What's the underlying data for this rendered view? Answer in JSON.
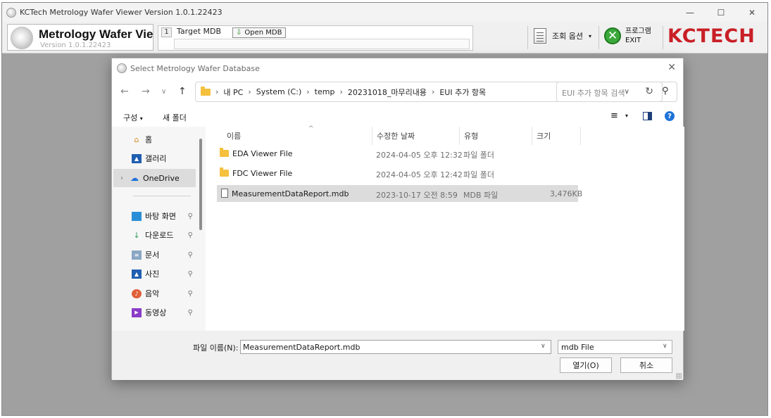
{
  "app": {
    "title": "KCTech Metrology Wafer Viewer Version 1.0.1.22423",
    "window_controls": {
      "minimize": "—",
      "maximize": "☐",
      "close": "✕"
    },
    "brand_title": "Metrology Wafer Viewer",
    "brand_version": "Version 1.0.1.22423",
    "mdb_index": "1",
    "target_mdb_label": "Target MDB",
    "open_mdb_label": "Open MDB",
    "target_mdb_value": "",
    "view_options_label": "조회 옵션",
    "exit_label_line1": "프로그램",
    "exit_label_line2": "EXIT",
    "logo_text": "KCTECH"
  },
  "dialog": {
    "title": "Select Metrology Wafer Database",
    "breadcrumb": [
      "내 PC",
      "System (C:)",
      "temp",
      "20231018_마무리내용",
      "EUI 추가 항목"
    ],
    "search_placeholder": "EUI 추가 항목 검색",
    "organize_label": "구성",
    "new_folder_label": "새 폴더",
    "sidebar": {
      "items": [
        {
          "label": "홈",
          "icon": "home-icon"
        },
        {
          "label": "갤러리",
          "icon": "gallery-icon"
        },
        {
          "label": "OneDrive",
          "icon": "cloud-icon",
          "selected": true
        },
        {
          "label": "바탕 화면",
          "icon": "desktop-icon",
          "pinned": true
        },
        {
          "label": "다운로드",
          "icon": "download-icon",
          "pinned": true
        },
        {
          "label": "문서",
          "icon": "documents-icon",
          "pinned": true
        },
        {
          "label": "사진",
          "icon": "pictures-icon",
          "pinned": true
        },
        {
          "label": "음악",
          "icon": "music-icon",
          "pinned": true
        },
        {
          "label": "동영상",
          "icon": "video-icon",
          "pinned": true
        }
      ]
    },
    "columns": {
      "name": "이름",
      "modified": "수정한 날짜",
      "type": "유형",
      "size": "크기"
    },
    "files": [
      {
        "name": "EDA Viewer File",
        "modified": "2024-04-05 오후 12:32",
        "type": "파일 폴더",
        "size": "",
        "kind": "folder"
      },
      {
        "name": "FDC Viewer File",
        "modified": "2024-04-05 오후 12:42",
        "type": "파일 폴더",
        "size": "",
        "kind": "folder"
      },
      {
        "name": "MeasurementDataReport.mdb",
        "modified": "2023-10-17 오전 8:59",
        "type": "MDB 파일",
        "size": "3,476KB",
        "kind": "file",
        "selected": true
      }
    ],
    "filename_label": "파일 이름(N):",
    "filename_value": "MeasurementDataReport.mdb",
    "filetype_value": "mdb File",
    "open_button": "열기(O)",
    "cancel_button": "취소"
  }
}
